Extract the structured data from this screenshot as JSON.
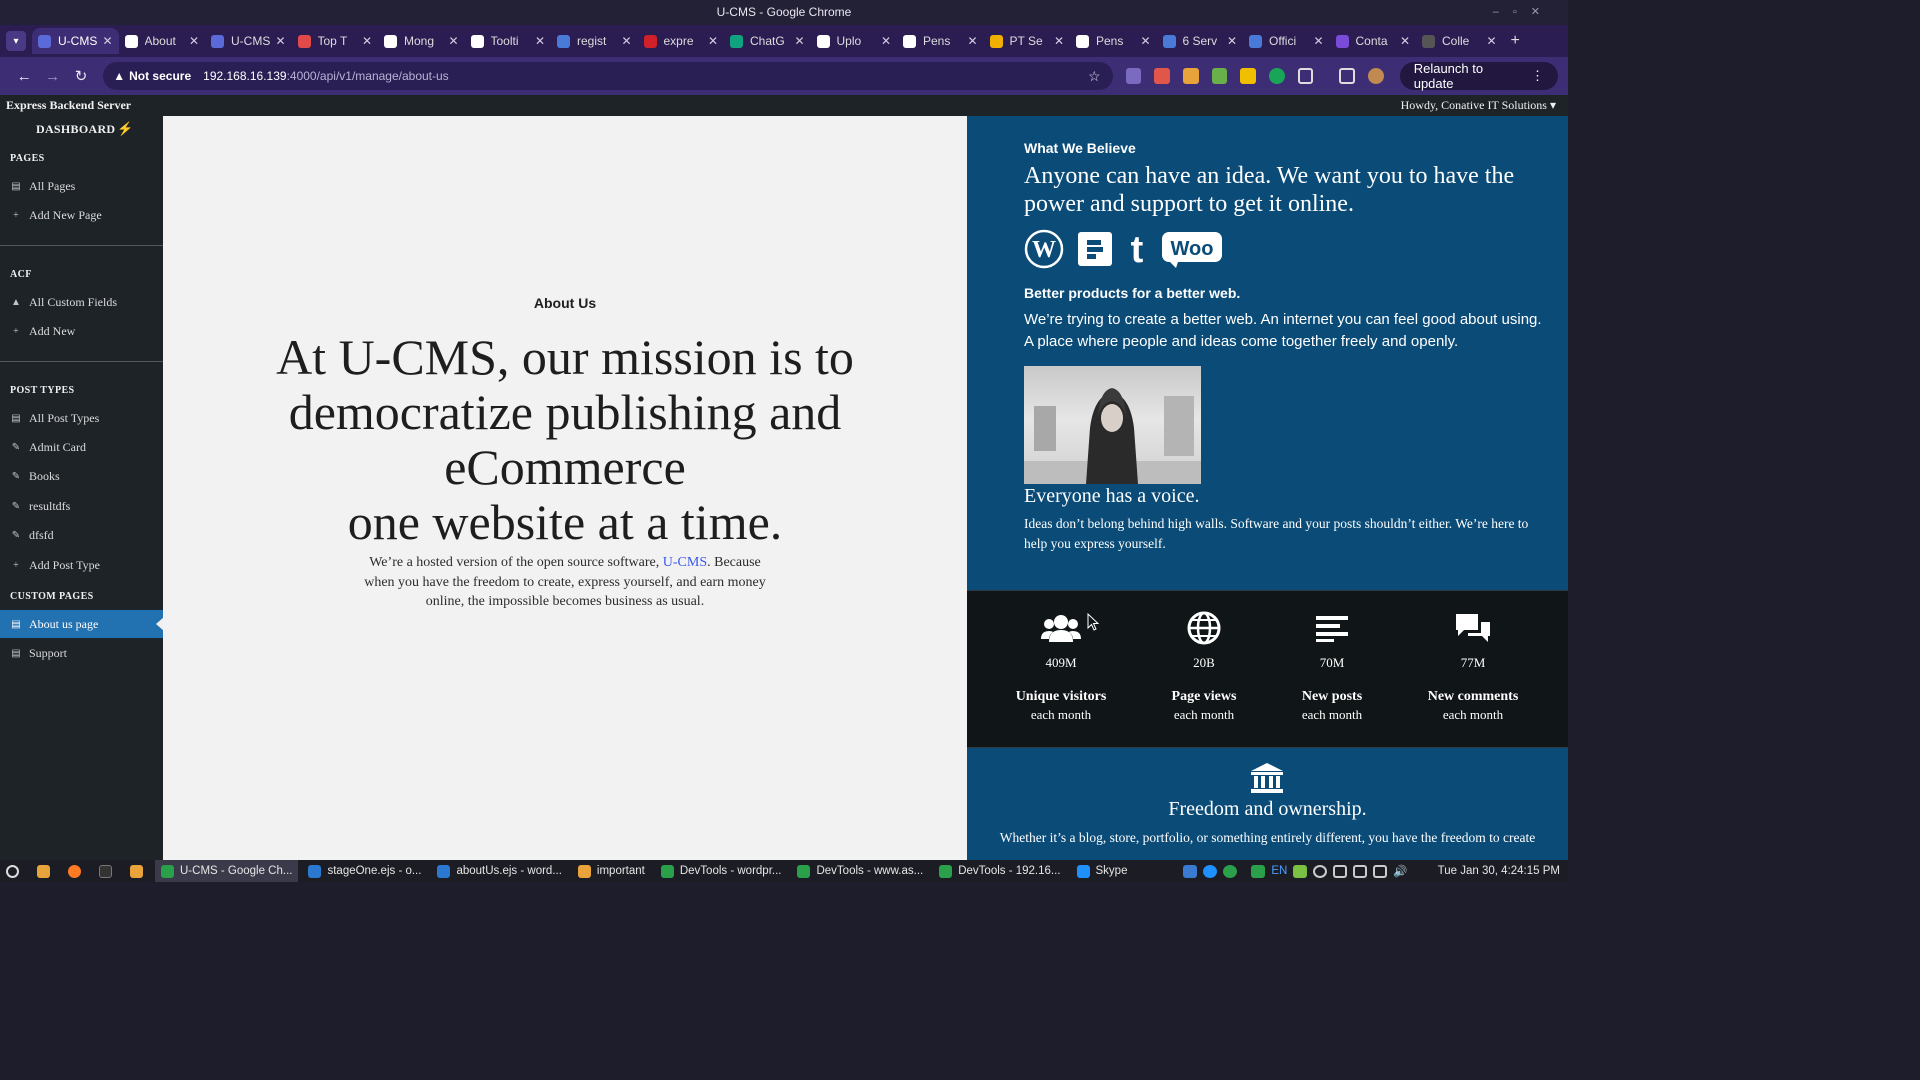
{
  "window": {
    "title": "U-CMS - Google Chrome"
  },
  "tabs": [
    {
      "label": "U-CMS",
      "color": "#5a6ad8",
      "active": true
    },
    {
      "label": "About",
      "color": "#ffffff"
    },
    {
      "label": "U-CMS",
      "color": "#5a6ad8"
    },
    {
      "label": "Top T",
      "color": "#e24a4a"
    },
    {
      "label": "Mong",
      "color": "#ffffff"
    },
    {
      "label": "Toolti",
      "color": "#ffffff"
    },
    {
      "label": "regist",
      "color": "#4a7ad8"
    },
    {
      "label": "expre",
      "color": "#d0202a"
    },
    {
      "label": "ChatG",
      "color": "#10a37f"
    },
    {
      "label": "Uplo",
      "color": "#ffffff"
    },
    {
      "label": "Pens",
      "color": "#ffffff"
    },
    {
      "label": "PT Se",
      "color": "#f0b000"
    },
    {
      "label": "Pens",
      "color": "#ffffff"
    },
    {
      "label": "6 Serv",
      "color": "#4a7ad8"
    },
    {
      "label": "Offici",
      "color": "#4a7ad8"
    },
    {
      "label": "Conta",
      "color": "#7a4ad8"
    },
    {
      "label": "Colle",
      "color": "#555555"
    }
  ],
  "address": {
    "security": "Not secure",
    "host": "192.168.16.139",
    "path": ":4000/api/v1/manage/about-us",
    "relaunch": "Relaunch to update"
  },
  "adminbar": {
    "brand": "Express Backend Server",
    "howdy": "Howdy, Conative IT Solutions"
  },
  "sidebar": {
    "dashboard": "DASHBOARD",
    "pages_heading": "PAGES",
    "all_pages": "All Pages",
    "add_new_page": "Add New Page",
    "acf_heading": "ACF",
    "all_custom_fields": "All Custom Fields",
    "add_new": "Add New",
    "post_types_heading": "POST TYPES",
    "all_post_types": "All Post Types",
    "admit_card": "Admit Card",
    "books": "Books",
    "resultdfs": "resultdfs",
    "dfsfd": "dfsfd",
    "add_post_type": "Add Post Type",
    "custom_pages_heading": "CUSTOM PAGES",
    "about_us_page": "About us page",
    "support": "Support"
  },
  "main": {
    "label": "About Us",
    "headline": "At U-CMS, our mission is to democratize publishing and eCommerce",
    "headline2": "one website at a time.",
    "desc_before": "We’re a hosted version of the open source software,",
    "desc_link": "U-CMS",
    "desc_after": ". Because when you have the freedom to create, express yourself, and earn money online, the impossible becomes business as usual."
  },
  "right": {
    "eyebrow": "What We Believe",
    "big": "Anyone can have an idea. We want you to have the power and support to get it online.",
    "logos": [
      "wordpress-logo",
      "simplenote-logo",
      "tumblr-logo",
      "woo-logo"
    ],
    "woo_text": "Woo",
    "sub": "Better products for a better web.",
    "para": "We’re trying to create a better web. An internet you can feel good about using. A place where people and ideas come together freely and openly.",
    "voice_title": "Everyone has a voice.",
    "voice_text": "Ideas don’t belong behind high walls. Software and your posts shouldn’t either. We’re here to help you express yourself."
  },
  "stats": [
    {
      "icon": "users-icon",
      "value": "409M",
      "title": "Unique visitors",
      "sub": "each month"
    },
    {
      "icon": "globe-icon",
      "value": "20B",
      "title": "Page views",
      "sub": "each month"
    },
    {
      "icon": "posts-icon",
      "value": "70M",
      "title": "New posts",
      "sub": "each month"
    },
    {
      "icon": "comments-icon",
      "value": "77M",
      "title": "New comments",
      "sub": "each month"
    }
  ],
  "freedom": {
    "title": "Freedom and ownership.",
    "text": "Whether it’s a blog, store, portfolio, or something entirely different, you have the freedom to create"
  },
  "taskbar": {
    "items": [
      {
        "label": "U-CMS - Google Ch...",
        "color": "#2aa04a",
        "active": true
      },
      {
        "label": "stageOne.ejs - o...",
        "color": "#2b78d0"
      },
      {
        "label": "aboutUs.ejs - word...",
        "color": "#2b78d0"
      },
      {
        "label": "important",
        "color": "#e8a33a"
      },
      {
        "label": "DevTools - wordpr...",
        "color": "#2aa04a"
      },
      {
        "label": "DevTools - www.as...",
        "color": "#2aa04a"
      },
      {
        "label": "DevTools - 192.16...",
        "color": "#2aa04a"
      },
      {
        "label": "Skype",
        "color": "#1e90ff"
      }
    ],
    "lang": "EN",
    "clock": "Tue Jan 30,  4:24:15 PM"
  }
}
